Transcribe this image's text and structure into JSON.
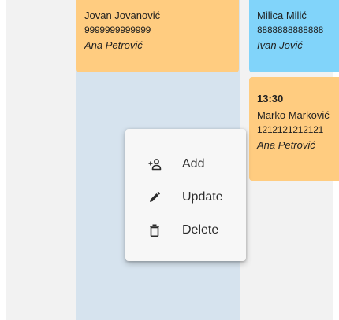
{
  "events": [
    {
      "id": "ev1",
      "time": "",
      "client": "Jovan Jovanović",
      "phone": "9999999999999",
      "staff": "Ana Petrović",
      "color": "#ffcc80"
    },
    {
      "id": "ev2",
      "time": "",
      "client": "Milica Milić",
      "phone": "8888888888888",
      "staff": "Ivan Jović",
      "color": "#81d4fa"
    },
    {
      "id": "ev3",
      "time": "13:30",
      "client": "Marko Marković",
      "phone": "1212121212121",
      "staff": "Ana Petrović",
      "color": "#ffcc80"
    }
  ],
  "context_menu": {
    "items": [
      {
        "label": "Add",
        "icon": "add-person-icon"
      },
      {
        "label": "Update",
        "icon": "pencil-icon"
      },
      {
        "label": "Delete",
        "icon": "trash-icon"
      }
    ]
  },
  "colors": {
    "column_highlight": "#d6e3ee",
    "column_background": "#f2f2f2",
    "event_orange": "#ffcc80",
    "event_blue": "#81d4fa",
    "menu_background": "#f7f7f7"
  }
}
